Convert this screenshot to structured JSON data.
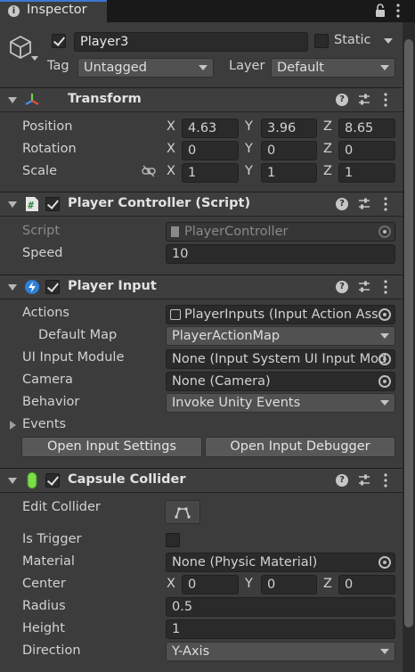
{
  "tab": {
    "title": "Inspector"
  },
  "header": {
    "name": "Player3",
    "active": true,
    "static_label": "Static",
    "tag_label": "Tag",
    "tag_value": "Untagged",
    "layer_label": "Layer",
    "layer_value": "Default"
  },
  "transform": {
    "title": "Transform",
    "position_label": "Position",
    "position": {
      "x": "4.63",
      "y": "3.96",
      "z": "8.65"
    },
    "rotation_label": "Rotation",
    "rotation": {
      "x": "0",
      "y": "0",
      "z": "0"
    },
    "scale_label": "Scale",
    "scale": {
      "x": "1",
      "y": "1",
      "z": "1"
    }
  },
  "player_controller": {
    "title": "Player Controller (Script)",
    "script_label": "Script",
    "script_value": "PlayerController",
    "speed_label": "Speed",
    "speed_value": "10"
  },
  "player_input": {
    "title": "Player Input",
    "actions_label": "Actions",
    "actions_value": "PlayerInputs (Input Action Ass",
    "default_map_label": "Default Map",
    "default_map_value": "PlayerActionMap",
    "ui_module_label": "UI Input Module",
    "ui_module_value": "None (Input System UI Input Mod",
    "camera_label": "Camera",
    "camera_value": "None (Camera)",
    "behavior_label": "Behavior",
    "behavior_value": "Invoke Unity Events",
    "events_label": "Events",
    "open_settings": "Open Input Settings",
    "open_debugger": "Open Input Debugger"
  },
  "capsule": {
    "title": "Capsule Collider",
    "edit_label": "Edit Collider",
    "trigger_label": "Is Trigger",
    "material_label": "Material",
    "material_value": "None (Physic Material)",
    "center_label": "Center",
    "center": {
      "x": "0",
      "y": "0",
      "z": "0"
    },
    "radius_label": "Radius",
    "radius_value": "0.5",
    "height_label": "Height",
    "height_value": "1",
    "direction_label": "Direction",
    "direction_value": "Y-Axis"
  },
  "axis": {
    "x": "X",
    "y": "Y",
    "z": "Z"
  },
  "icons": {
    "tab": "info-icon",
    "lock": "lock-icon",
    "menu": "kebab-menu-icon",
    "object": "cube-icon",
    "transform": "transform-axes-icon",
    "script": "script-icon",
    "input": "lightning-icon",
    "collider": "capsule-icon",
    "help": "help-icon",
    "preset": "preset-sliders-icon",
    "link": "link-icon",
    "edit": "edit-collider-icon",
    "picker": "object-picker-icon"
  },
  "colors": {
    "panel": "#3c3c3c",
    "field": "#2a2a2a",
    "accent": "#3a78d2"
  }
}
